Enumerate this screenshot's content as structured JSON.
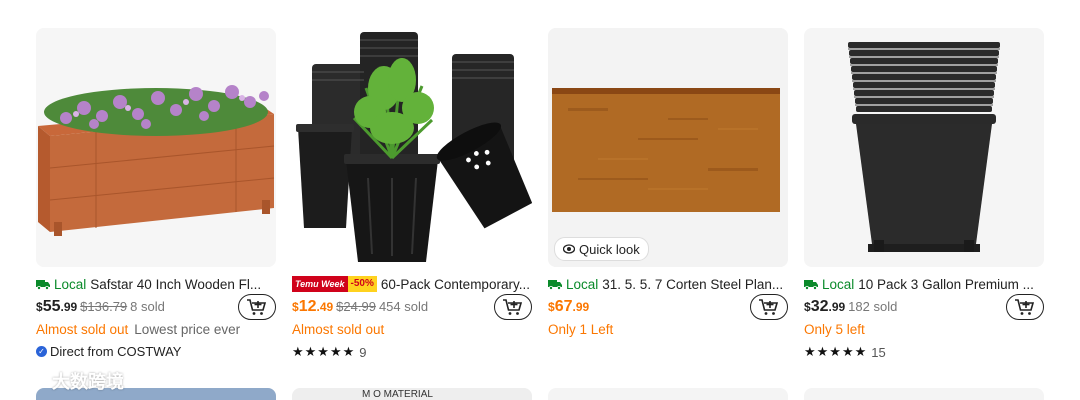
{
  "products": [
    {
      "local_label": "Local",
      "title": "Safstar 40 Inch Wooden Fl...",
      "price_symbol": "$",
      "price_whole": "55",
      "price_cents": ".99",
      "original_price": "$136.79",
      "sold": "8 sold",
      "status": "Almost sold out",
      "status_extra": "Lowest price ever",
      "seller": "Direct from COSTWAY"
    },
    {
      "badge_week": "Temu Week",
      "badge_discount": "-50%",
      "title": "60-Pack Contemporary...",
      "price_symbol": "$",
      "price_whole": "12",
      "price_cents": ".49",
      "original_price": "$24.99",
      "sold": "454 sold",
      "status": "Almost sold out",
      "stars": "★★★★★",
      "rating_count": "9"
    },
    {
      "local_label": "Local",
      "title": "31. 5. 5. 7 Corten Steel Plan...",
      "price_symbol": "$",
      "price_whole": "67",
      "price_cents": ".99",
      "status": "Only 1 Left",
      "quick_look": "Quick look"
    },
    {
      "local_label": "Local",
      "title": "10 Pack 3 Gallon Premium ...",
      "price_symbol": "$",
      "price_whole": "32",
      "price_cents": ".99",
      "sold": "182 sold",
      "status": "Only 5 left",
      "stars": "★★★★★",
      "rating_count": "15"
    }
  ],
  "next_row_caption": "M O MATERIAL",
  "watermark": "大数跨境",
  "colors": {
    "accent_orange": "#fb7701",
    "local_green": "#0a8a2a",
    "badge_red": "#d0021b",
    "badge_yellow": "#ffd21f"
  }
}
